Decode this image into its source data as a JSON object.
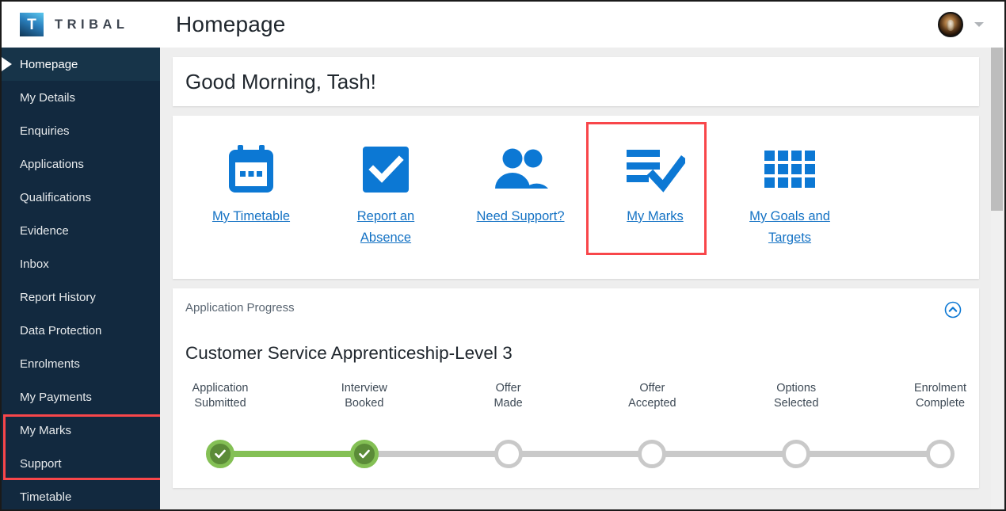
{
  "header": {
    "logo_letter": "T",
    "brand_name": "TRIBAL",
    "page_title": "Homepage",
    "avatar_name": "user-avatar",
    "caret_name": "account-menu-caret"
  },
  "sidebar": {
    "items": [
      {
        "label": "Homepage",
        "active": true
      },
      {
        "label": "My Details",
        "active": false
      },
      {
        "label": "Enquiries",
        "active": false
      },
      {
        "label": "Applications",
        "active": false
      },
      {
        "label": "Qualifications",
        "active": false
      },
      {
        "label": "Evidence",
        "active": false
      },
      {
        "label": "Inbox",
        "active": false
      },
      {
        "label": "Report History",
        "active": false
      },
      {
        "label": "Data Protection",
        "active": false
      },
      {
        "label": "Enrolments",
        "active": false
      },
      {
        "label": "My Payments",
        "active": false
      },
      {
        "label": "My Marks",
        "active": false
      },
      {
        "label": "Support",
        "active": false
      },
      {
        "label": "Timetable",
        "active": false
      }
    ],
    "highlight_color": "#f8464a"
  },
  "greeting": {
    "text": "Good Morning, Tash!"
  },
  "quick_links": {
    "items": [
      {
        "label": "My Timetable",
        "icon": "calendar-icon"
      },
      {
        "label": "Report an Absence",
        "icon": "checkbox-checked-icon"
      },
      {
        "label": "Need Support?",
        "icon": "people-icon"
      },
      {
        "label": "My Marks",
        "icon": "marks-checklist-icon",
        "highlighted": true
      },
      {
        "label": "My Goals and Targets",
        "icon": "grid-icon"
      }
    ],
    "link_color": "#1472c4",
    "highlight_color": "#f8464a"
  },
  "application_progress": {
    "panel_label": "Application Progress",
    "collapse_icon": "chevron-up-circle-icon",
    "course_title": "Customer Service Apprenticeship-Level 3",
    "steps": [
      {
        "label": "Application\nSubmitted",
        "state": "done"
      },
      {
        "label": "Interview\nBooked",
        "state": "done"
      },
      {
        "label": "Offer\nMade",
        "state": "todo"
      },
      {
        "label": "Offer\nAccepted",
        "state": "todo"
      },
      {
        "label": "Options\nSelected",
        "state": "todo"
      },
      {
        "label": "Enrolment\nComplete",
        "state": "todo"
      }
    ],
    "done_color": "#84c055",
    "done_fill_color": "#5b8b38",
    "todo_color": "#c9c9c9"
  },
  "scrollbar": {
    "name": "main-vertical-scrollbar"
  }
}
